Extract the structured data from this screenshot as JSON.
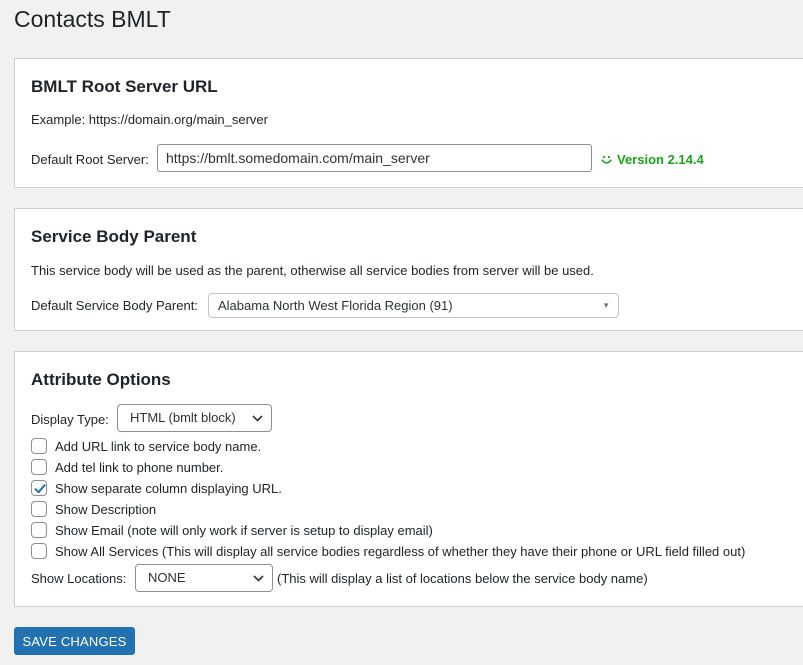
{
  "page": {
    "title": "Contacts BMLT"
  },
  "root_server": {
    "heading": "BMLT Root Server URL",
    "example": "Example: https://domain.org/main_server",
    "label": "Default Root Server:",
    "value": "https://bmlt.somedomain.com/main_server",
    "version": "Version 2.14.4"
  },
  "service_body": {
    "heading": "Service Body Parent",
    "description": "This service body will be used as the parent, otherwise all service bodies from server will be used.",
    "label": "Default Service Body Parent:",
    "selected": "Alabama North West Florida Region (91)"
  },
  "attributes": {
    "heading": "Attribute Options",
    "display_type_label": "Display Type:",
    "display_type_selected": "HTML (bmlt block)",
    "options": [
      {
        "label": "Add URL link to service body name.",
        "checked": false
      },
      {
        "label": "Add tel link to phone number.",
        "checked": false
      },
      {
        "label": "Show separate column displaying URL.",
        "checked": true
      },
      {
        "label": "Show Description",
        "checked": false
      },
      {
        "label": "Show Email (note will only work if server is setup to display email)",
        "checked": false
      },
      {
        "label": "Show All Services (This will display all service bodies regardless of whether they have their phone or URL field filled out)",
        "checked": false
      }
    ],
    "show_locations_label": "Show Locations:",
    "show_locations_selected": "NONE",
    "show_locations_note": "(This will display a list of locations below the service body name)"
  },
  "save_button": {
    "label": "SAVE CHANGES"
  },
  "colors": {
    "accent": "#2271b1",
    "success": "#1aa31a",
    "check": "#2271b1"
  }
}
